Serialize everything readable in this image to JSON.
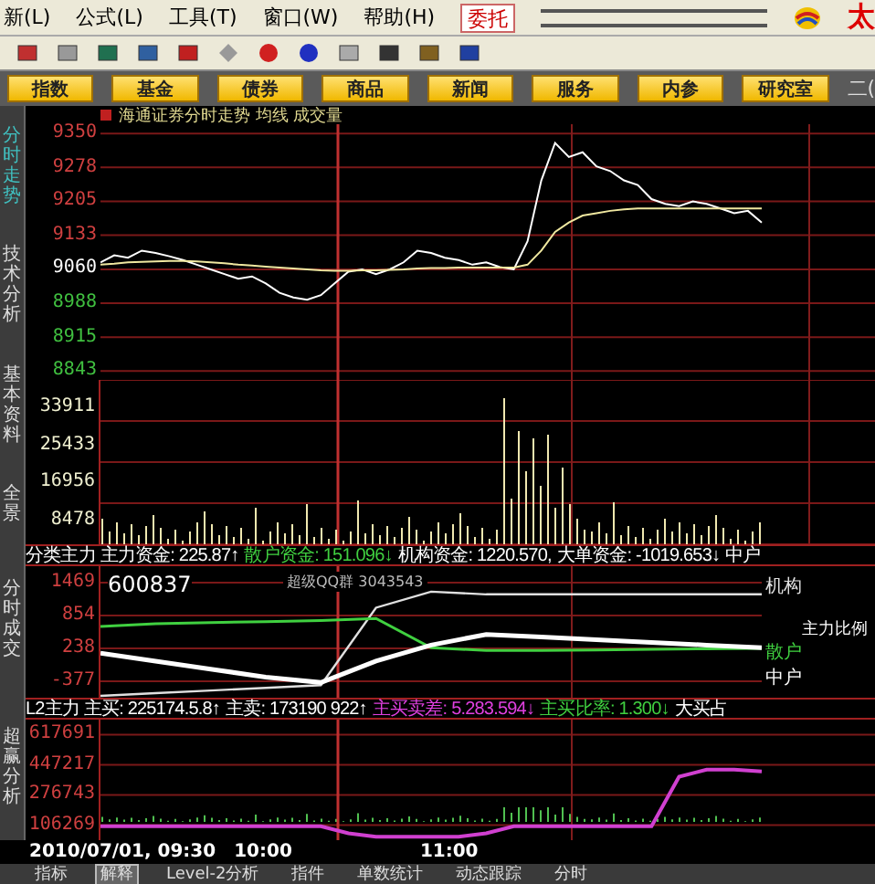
{
  "menu": [
    {
      "label": "新(L)"
    },
    {
      "label": "公式(L)"
    },
    {
      "label": "工具(T)"
    },
    {
      "label": "窗口(W)"
    },
    {
      "label": "帮助(H)"
    }
  ],
  "entrust_button": "委托",
  "logo_text": "太",
  "quick_buttons": [
    {
      "label": "指数"
    },
    {
      "label": "基金"
    },
    {
      "label": "债券"
    },
    {
      "label": "商品"
    },
    {
      "label": "新闻"
    },
    {
      "label": "服务"
    },
    {
      "label": "内参"
    },
    {
      "label": "研究室"
    }
  ],
  "quick_button_cut": "二(",
  "side_tabs_top": [
    {
      "label": "分时走势",
      "selected": true
    },
    {
      "label": "技术分析",
      "selected": false
    },
    {
      "label": "基本资料",
      "selected": false
    },
    {
      "label": "全景",
      "selected": false
    }
  ],
  "side_tabs_bottom": [
    {
      "label": "分时成交",
      "selected": false
    },
    {
      "label": "超赢分析",
      "selected": false
    }
  ],
  "price_chart": {
    "chart_data": {
      "type": "line",
      "title": "海通证券分时走势 均线 成交量",
      "ylim": [
        8824,
        9370
      ],
      "grid": true,
      "yticks": [
        9350,
        9278,
        9205,
        9133,
        9060,
        8988,
        8915,
        8843
      ],
      "series": [
        {
          "color": "#ffffff",
          "values": [
            9075,
            9090,
            9085,
            9100,
            9095,
            9088,
            9080,
            9070,
            9060,
            9050,
            9040,
            9045,
            9030,
            9010,
            9000,
            8995,
            9005,
            9030,
            9055,
            9060,
            9050,
            9060,
            9075,
            9100,
            9095,
            9085,
            9080,
            9070,
            9075,
            9065,
            9060,
            9120,
            9250,
            9330,
            9300,
            9310,
            9280,
            9270,
            9250,
            9240,
            9210,
            9200,
            9195,
            9205,
            9200,
            9190,
            9180,
            9185,
            9160
          ]
        },
        {
          "color": "#f0e8a0",
          "values": [
            9070,
            9072,
            9075,
            9076,
            9077,
            9078,
            9078,
            9077,
            9075,
            9073,
            9070,
            9068,
            9066,
            9064,
            9062,
            9060,
            9058,
            9057,
            9057,
            9058,
            9058,
            9059,
            9060,
            9062,
            9063,
            9063,
            9064,
            9064,
            9064,
            9064,
            9064,
            9070,
            9100,
            9140,
            9160,
            9175,
            9180,
            9185,
            9188,
            9190,
            9190,
            9190,
            9190,
            9190,
            9190,
            9190,
            9190,
            9190,
            9190
          ]
        }
      ]
    }
  },
  "volume_labels": [
    "33911",
    "25433",
    "16956",
    "8478"
  ],
  "strip_1": [
    {
      "text": "分类主力 主力资金: 225.87↑",
      "color": "#ffffff"
    },
    {
      "text": "散户资金: 151.096↓",
      "color": "#40d040"
    },
    {
      "text": "机构资金: 1220.570,",
      "color": "#ffffff"
    },
    {
      "text": "大单资金: -1019.653↓",
      "color": "#ffffff"
    },
    {
      "text": "中户",
      "color": "#ffffff"
    }
  ],
  "flow_panel": {
    "code": "600837",
    "group": "超级QQ群 3043543",
    "ratio_label": "主力比例",
    "chart_data": {
      "type": "line",
      "ylim": [
        -685,
        1777
      ],
      "grid": true,
      "yticks": [
        1469,
        854,
        238,
        -377
      ],
      "series": [
        {
          "name": "机构",
          "color": "#e0e0e0",
          "values": [
            -650,
            -600,
            -550,
            -500,
            -450,
            1000,
            1300,
            1250,
            1250,
            1250,
            1250,
            1250,
            1250
          ]
        },
        {
          "name": "散户",
          "color": "#40d040",
          "values": [
            650,
            700,
            720,
            740,
            760,
            800,
            250,
            200,
            200,
            210,
            220,
            230,
            240
          ]
        },
        {
          "name": "中户",
          "color": "#ffffff",
          "values": [
            150,
            0,
            -150,
            -300,
            -400,
            0,
            300,
            500,
            450,
            400,
            350,
            300,
            250
          ]
        }
      ]
    }
  },
  "strip_2": [
    {
      "text": "L2主力 主买: 225174.5.8↑",
      "color": "#ffffff"
    },
    {
      "text": "主卖: 173190 922↑",
      "color": "#ffffff"
    },
    {
      "text": "主买卖差: 5.283.594↓",
      "color": "#e040e0"
    },
    {
      "text": "主买比率: 1.300↓",
      "color": "#40d040"
    },
    {
      "text": "大买占",
      "color": "#ffffff"
    }
  ],
  "order_panel": {
    "chart_data": {
      "type": "line",
      "ylim": [
        21000,
        703000
      ],
      "grid": true,
      "yticks": [
        617691,
        447217,
        276743,
        106269
      ],
      "series": [
        {
          "color": "#d040d0",
          "values": [
            100000,
            100000,
            100000,
            100000,
            100000,
            100000,
            100000,
            100000,
            100000,
            60000,
            40000,
            40000,
            40000,
            40000,
            60000,
            100000,
            100000,
            100000,
            100000,
            100000,
            100000,
            380000,
            420000,
            420000,
            410000
          ]
        }
      ]
    }
  },
  "time_labels": [
    "2010/07/01, 09:30",
    "10:00",
    "11:00"
  ],
  "bottom_tabs": [
    {
      "label": "指标",
      "selected": false
    },
    {
      "label": "解释",
      "selected": true
    },
    {
      "label": "Level-2分析",
      "selected": false
    },
    {
      "label": "指件",
      "selected": false
    },
    {
      "label": "单数统计",
      "selected": false
    },
    {
      "label": "动态跟踪",
      "selected": false
    },
    {
      "label": "分时",
      "selected": false
    }
  ]
}
